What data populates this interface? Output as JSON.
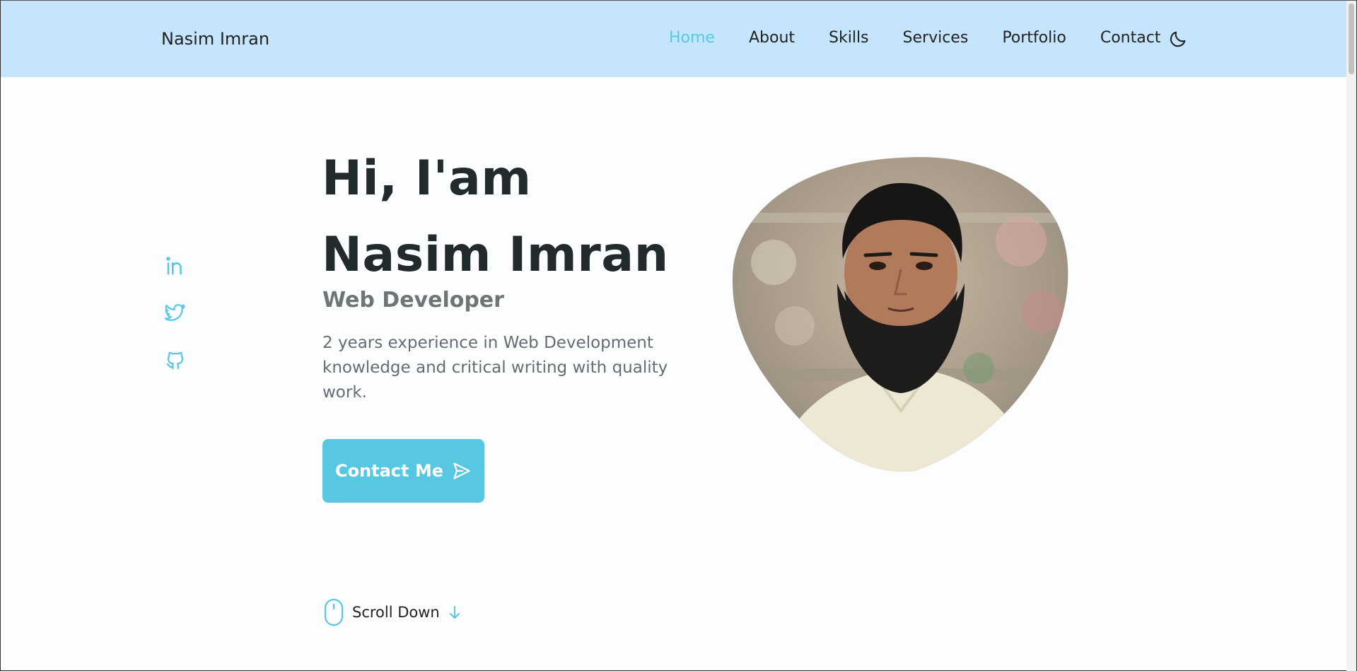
{
  "header": {
    "logo": "Nasim Imran",
    "nav": [
      "Home",
      "About",
      "Skills",
      "Services",
      "Portfolio",
      "Contact"
    ],
    "active_nav": "Home",
    "theme_icon": "moon-icon"
  },
  "social": [
    "linkedin-icon",
    "twitter-icon",
    "github-icon"
  ],
  "hero": {
    "line1": "Hi, I'am",
    "line2": "Nasim Imran",
    "subtitle": "Web Developer",
    "description": "2 years experience in Web Development knowledge and critical writing with quality work.",
    "cta": "Contact Me",
    "cta_icon": "send-icon"
  },
  "scroll": {
    "label": "Scroll Down",
    "icon": "mouse-icon",
    "arrow": "arrow-down-icon"
  },
  "colors": {
    "accent": "#58c8e2",
    "header_bg": "#c5e5fc",
    "title": "#222a2d",
    "text": "#656d70"
  }
}
